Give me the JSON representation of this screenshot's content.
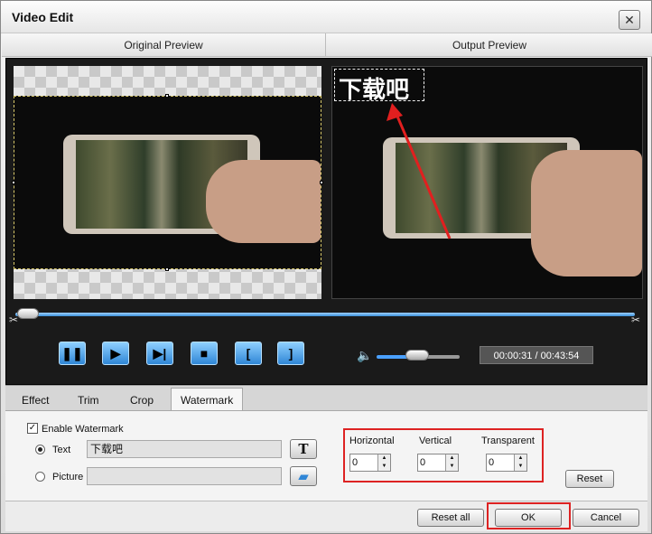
{
  "window": {
    "title": "Video Edit"
  },
  "previews": {
    "original_label": "Original Preview",
    "output_label": "Output Preview"
  },
  "watermark_overlay_text": "下载吧",
  "player": {
    "time": "00:00:31 / 00:43:54",
    "seek_position": 0.02,
    "volume_level": 0.45
  },
  "tabs": [
    {
      "label": "Effect",
      "active": false
    },
    {
      "label": "Trim",
      "active": false
    },
    {
      "label": "Crop",
      "active": false
    },
    {
      "label": "Watermark",
      "active": true
    }
  ],
  "watermark": {
    "enable_label": "Enable Watermark",
    "enabled": true,
    "text_label": "Text",
    "text_value": "下载吧",
    "text_selected": true,
    "picture_label": "Picture",
    "picture_value": "",
    "horizontal_label": "Horizontal",
    "vertical_label": "Vertical",
    "transparent_label": "Transparent",
    "horizontal_value": "0",
    "vertical_value": "0",
    "transparent_value": "0",
    "reset_label": "Reset"
  },
  "footer": {
    "reset_all_label": "Reset all",
    "ok_label": "OK",
    "cancel_label": "Cancel"
  },
  "colors": {
    "accent_blue": "#2f86d6",
    "highlight_red": "#d22222"
  }
}
